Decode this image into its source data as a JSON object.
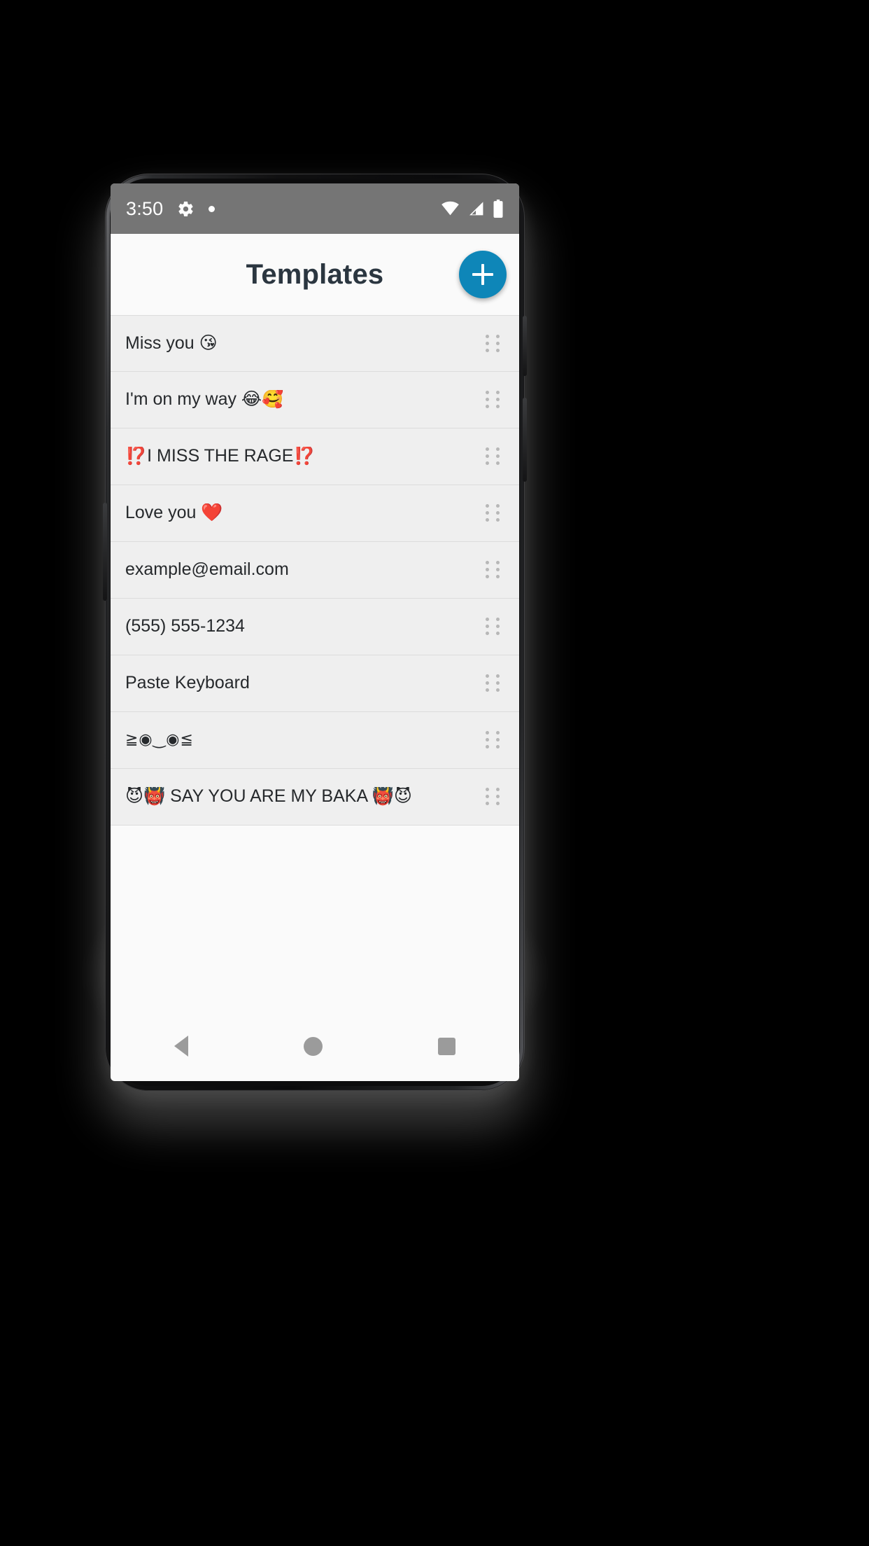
{
  "statusbar": {
    "time": "3:50",
    "left_icons": [
      "gear-icon",
      "dot-indicator-icon"
    ],
    "right_icons": [
      "wifi-icon",
      "cell-signal-icon",
      "battery-icon"
    ]
  },
  "appbar": {
    "title": "Templates",
    "fab_label": "+",
    "fab_color": "#0e86b8"
  },
  "list": {
    "rows": [
      {
        "text": "Miss you 😘",
        "handle": "drag-handle-icon"
      },
      {
        "text": "I'm on my way 😂🥰",
        "handle": "drag-handle-icon"
      },
      {
        "text": "⁉️I MISS THE RAGE⁉️",
        "handle": "drag-handle-icon"
      },
      {
        "text": "Love you ❤️",
        "handle": "drag-handle-icon"
      },
      {
        "text": "example@email.com",
        "handle": "drag-handle-icon"
      },
      {
        "text": "(555) 555-1234",
        "handle": "drag-handle-icon"
      },
      {
        "text": "Paste Keyboard",
        "handle": "drag-handle-icon"
      },
      {
        "text": "≧◉‿◉≦",
        "handle": "drag-handle-icon",
        "style": "mono"
      },
      {
        "text": "😈👹 SAY YOU ARE MY BAKA 👹😈",
        "handle": "drag-handle-icon"
      }
    ]
  },
  "navbar": {
    "back": "back-triangle-icon",
    "home": "home-circle-icon",
    "recents": "recents-square-icon"
  },
  "colors": {
    "status_bar": "#757575",
    "app_bar": "#fafafa",
    "row": "#efefef",
    "divider": "#dcdcdc",
    "title": "#2b3640",
    "accent": "#0e86b8",
    "highlight": "#ea3323"
  }
}
